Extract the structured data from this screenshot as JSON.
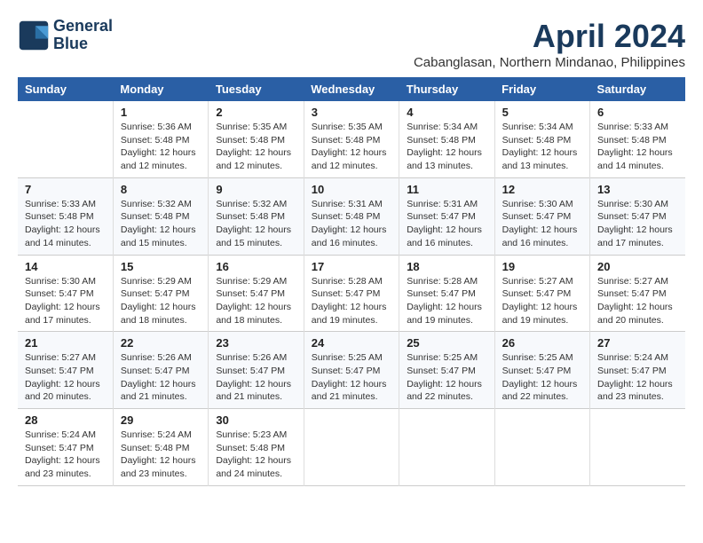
{
  "header": {
    "logo_line1": "General",
    "logo_line2": "Blue",
    "title": "April 2024",
    "subtitle": "Cabanglasan, Northern Mindanao, Philippines"
  },
  "columns": [
    "Sunday",
    "Monday",
    "Tuesday",
    "Wednesday",
    "Thursday",
    "Friday",
    "Saturday"
  ],
  "weeks": [
    [
      {
        "day": "",
        "info": ""
      },
      {
        "day": "1",
        "info": "Sunrise: 5:36 AM\nSunset: 5:48 PM\nDaylight: 12 hours\nand 12 minutes."
      },
      {
        "day": "2",
        "info": "Sunrise: 5:35 AM\nSunset: 5:48 PM\nDaylight: 12 hours\nand 12 minutes."
      },
      {
        "day": "3",
        "info": "Sunrise: 5:35 AM\nSunset: 5:48 PM\nDaylight: 12 hours\nand 12 minutes."
      },
      {
        "day": "4",
        "info": "Sunrise: 5:34 AM\nSunset: 5:48 PM\nDaylight: 12 hours\nand 13 minutes."
      },
      {
        "day": "5",
        "info": "Sunrise: 5:34 AM\nSunset: 5:48 PM\nDaylight: 12 hours\nand 13 minutes."
      },
      {
        "day": "6",
        "info": "Sunrise: 5:33 AM\nSunset: 5:48 PM\nDaylight: 12 hours\nand 14 minutes."
      }
    ],
    [
      {
        "day": "7",
        "info": "Sunrise: 5:33 AM\nSunset: 5:48 PM\nDaylight: 12 hours\nand 14 minutes."
      },
      {
        "day": "8",
        "info": "Sunrise: 5:32 AM\nSunset: 5:48 PM\nDaylight: 12 hours\nand 15 minutes."
      },
      {
        "day": "9",
        "info": "Sunrise: 5:32 AM\nSunset: 5:48 PM\nDaylight: 12 hours\nand 15 minutes."
      },
      {
        "day": "10",
        "info": "Sunrise: 5:31 AM\nSunset: 5:48 PM\nDaylight: 12 hours\nand 16 minutes."
      },
      {
        "day": "11",
        "info": "Sunrise: 5:31 AM\nSunset: 5:47 PM\nDaylight: 12 hours\nand 16 minutes."
      },
      {
        "day": "12",
        "info": "Sunrise: 5:30 AM\nSunset: 5:47 PM\nDaylight: 12 hours\nand 16 minutes."
      },
      {
        "day": "13",
        "info": "Sunrise: 5:30 AM\nSunset: 5:47 PM\nDaylight: 12 hours\nand 17 minutes."
      }
    ],
    [
      {
        "day": "14",
        "info": "Sunrise: 5:30 AM\nSunset: 5:47 PM\nDaylight: 12 hours\nand 17 minutes."
      },
      {
        "day": "15",
        "info": "Sunrise: 5:29 AM\nSunset: 5:47 PM\nDaylight: 12 hours\nand 18 minutes."
      },
      {
        "day": "16",
        "info": "Sunrise: 5:29 AM\nSunset: 5:47 PM\nDaylight: 12 hours\nand 18 minutes."
      },
      {
        "day": "17",
        "info": "Sunrise: 5:28 AM\nSunset: 5:47 PM\nDaylight: 12 hours\nand 19 minutes."
      },
      {
        "day": "18",
        "info": "Sunrise: 5:28 AM\nSunset: 5:47 PM\nDaylight: 12 hours\nand 19 minutes."
      },
      {
        "day": "19",
        "info": "Sunrise: 5:27 AM\nSunset: 5:47 PM\nDaylight: 12 hours\nand 19 minutes."
      },
      {
        "day": "20",
        "info": "Sunrise: 5:27 AM\nSunset: 5:47 PM\nDaylight: 12 hours\nand 20 minutes."
      }
    ],
    [
      {
        "day": "21",
        "info": "Sunrise: 5:27 AM\nSunset: 5:47 PM\nDaylight: 12 hours\nand 20 minutes."
      },
      {
        "day": "22",
        "info": "Sunrise: 5:26 AM\nSunset: 5:47 PM\nDaylight: 12 hours\nand 21 minutes."
      },
      {
        "day": "23",
        "info": "Sunrise: 5:26 AM\nSunset: 5:47 PM\nDaylight: 12 hours\nand 21 minutes."
      },
      {
        "day": "24",
        "info": "Sunrise: 5:25 AM\nSunset: 5:47 PM\nDaylight: 12 hours\nand 21 minutes."
      },
      {
        "day": "25",
        "info": "Sunrise: 5:25 AM\nSunset: 5:47 PM\nDaylight: 12 hours\nand 22 minutes."
      },
      {
        "day": "26",
        "info": "Sunrise: 5:25 AM\nSunset: 5:47 PM\nDaylight: 12 hours\nand 22 minutes."
      },
      {
        "day": "27",
        "info": "Sunrise: 5:24 AM\nSunset: 5:47 PM\nDaylight: 12 hours\nand 23 minutes."
      }
    ],
    [
      {
        "day": "28",
        "info": "Sunrise: 5:24 AM\nSunset: 5:47 PM\nDaylight: 12 hours\nand 23 minutes."
      },
      {
        "day": "29",
        "info": "Sunrise: 5:24 AM\nSunset: 5:48 PM\nDaylight: 12 hours\nand 23 minutes."
      },
      {
        "day": "30",
        "info": "Sunrise: 5:23 AM\nSunset: 5:48 PM\nDaylight: 12 hours\nand 24 minutes."
      },
      {
        "day": "",
        "info": ""
      },
      {
        "day": "",
        "info": ""
      },
      {
        "day": "",
        "info": ""
      },
      {
        "day": "",
        "info": ""
      }
    ]
  ]
}
